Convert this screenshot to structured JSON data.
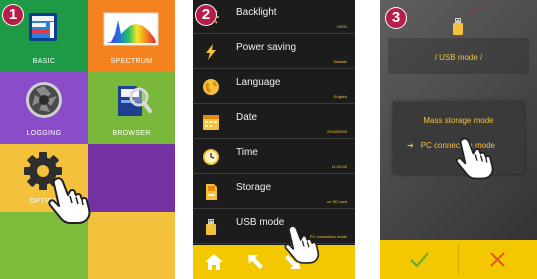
{
  "steps": [
    "1",
    "2",
    "3"
  ],
  "home_menu": {
    "tiles": [
      {
        "label": "BASIC",
        "color": "#1e9a46"
      },
      {
        "label": "SPECTRUM",
        "color": "#f4821f"
      },
      {
        "label": "LOGGING",
        "color": "#8a4cc8"
      },
      {
        "label": "BROWSER",
        "color": "#79b83a"
      },
      {
        "label": "OPTION",
        "color": "#f3c13c"
      }
    ]
  },
  "option_menu": {
    "items": [
      {
        "label": "Backlight",
        "value": "100%",
        "icon": "backlight-icon"
      },
      {
        "label": "Power saving",
        "value": "Disable",
        "icon": "lightning-icon"
      },
      {
        "label": "Language",
        "value": "English",
        "icon": "globe-icon"
      },
      {
        "label": "Date",
        "value": "2016/00/00",
        "icon": "calendar-icon"
      },
      {
        "label": "Time",
        "value": "11:00:00",
        "icon": "clock-icon"
      },
      {
        "label": "Storage",
        "value": "on SD card",
        "icon": "sd-card-icon"
      },
      {
        "label": "USB mode",
        "value": "PC connection mode",
        "icon": "usb-icon"
      }
    ],
    "nav": [
      "home-icon",
      "back-arrow-icon",
      "down-arrow-icon"
    ]
  },
  "usb_mode": {
    "title": "/ USB mode /",
    "options": [
      "Mass storage mode",
      "PC connection mode"
    ],
    "selected_index": 1,
    "selected_marker": "➔",
    "actions": [
      "checkmark-icon",
      "cross-icon"
    ]
  },
  "colors": {
    "accent_yellow": "#f3c800",
    "text_yellow": "#f3c13c",
    "badge": "#b51e48",
    "menu_bg": "#1c1c1c"
  }
}
